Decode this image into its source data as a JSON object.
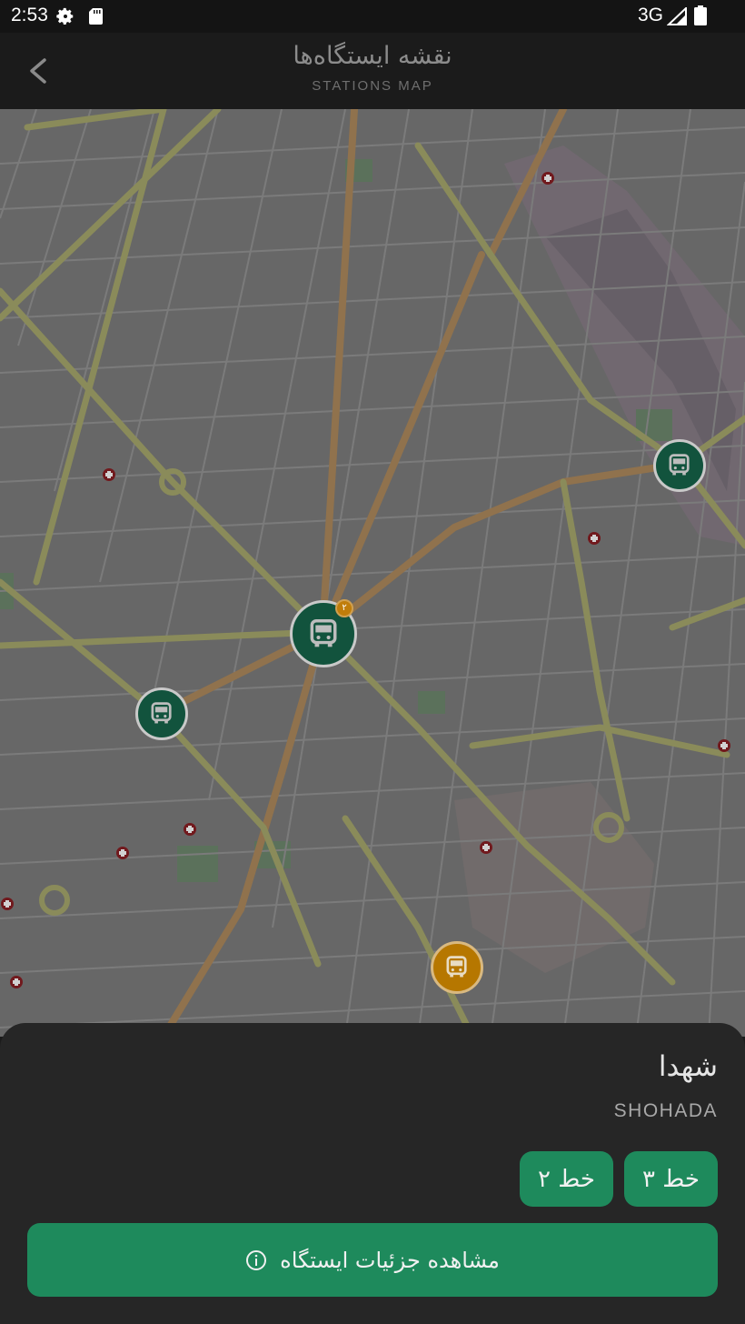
{
  "status_bar": {
    "time": "2:53",
    "network": "3G",
    "icons": [
      "settings-gear-icon",
      "sd-card-icon",
      "signal-icon",
      "battery-icon"
    ]
  },
  "header": {
    "title_fa": "نقشه ایستگاه‌ها",
    "title_en": "STATIONS MAP",
    "back_icon": "chevron-left-icon"
  },
  "map": {
    "markers": [
      {
        "name": "station-marker",
        "state": "normal",
        "color": "#12533d"
      },
      {
        "name": "station-marker",
        "state": "selected",
        "color": "#12533d",
        "badge": "۲"
      },
      {
        "name": "station-marker",
        "state": "normal",
        "color": "#12533d"
      },
      {
        "name": "station-marker",
        "state": "highlighted",
        "color": "#b67700"
      }
    ]
  },
  "station": {
    "name_fa": "شهدا",
    "name_en": "SHOHADA",
    "lines": [
      "خط ۳",
      "خط ۲"
    ],
    "details_button": "مشاهده جزئیات ایستگاه"
  },
  "colors": {
    "accent": "#1e8a5c",
    "sheet": "#262626",
    "marker_green": "#12533d",
    "marker_orange": "#b67700"
  }
}
